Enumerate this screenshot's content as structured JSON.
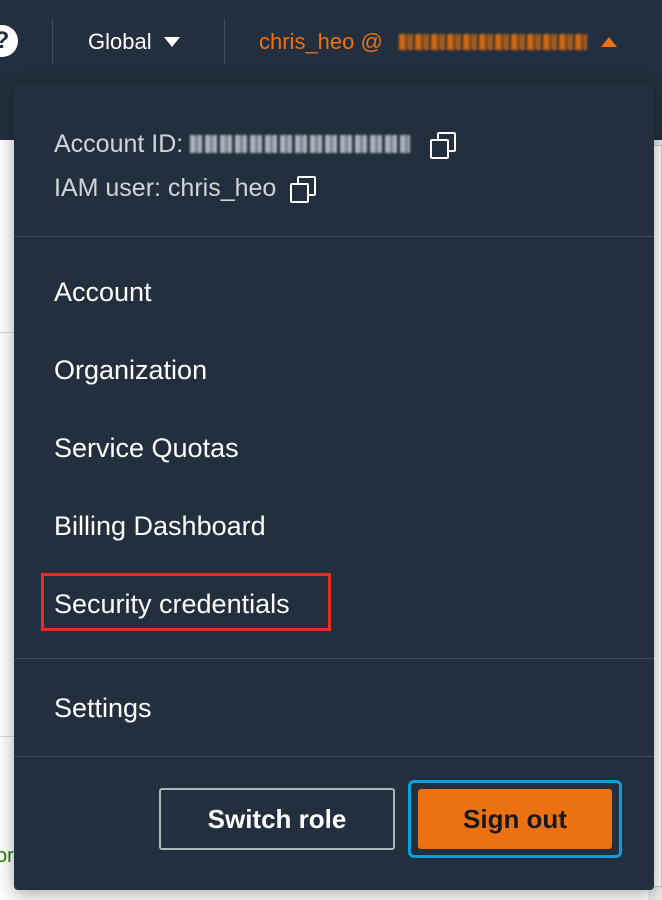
{
  "header": {
    "help_icon": "?",
    "region_label": "Global",
    "account_menu_user": "chris_heo @ "
  },
  "account_info": {
    "account_id_label": "Account ID: ",
    "iam_user_label": "IAM user: chris_heo"
  },
  "menu": {
    "items": [
      {
        "label": "Account"
      },
      {
        "label": "Organization"
      },
      {
        "label": "Service Quotas"
      },
      {
        "label": "Billing Dashboard"
      },
      {
        "label": "Security credentials"
      },
      {
        "label": "Settings"
      }
    ]
  },
  "buttons": {
    "switch_role": "Switch role",
    "sign_out": "Sign out"
  },
  "page": {
    "partial_text": "or"
  },
  "colors": {
    "nav_bg": "#232f3e",
    "accent_orange": "#ec7211",
    "highlight_red": "#e3311d",
    "focus_blue": "#0aa0d8"
  },
  "icons": [
    "help-icon",
    "caret-down-icon",
    "caret-up-icon",
    "copy-icon"
  ]
}
